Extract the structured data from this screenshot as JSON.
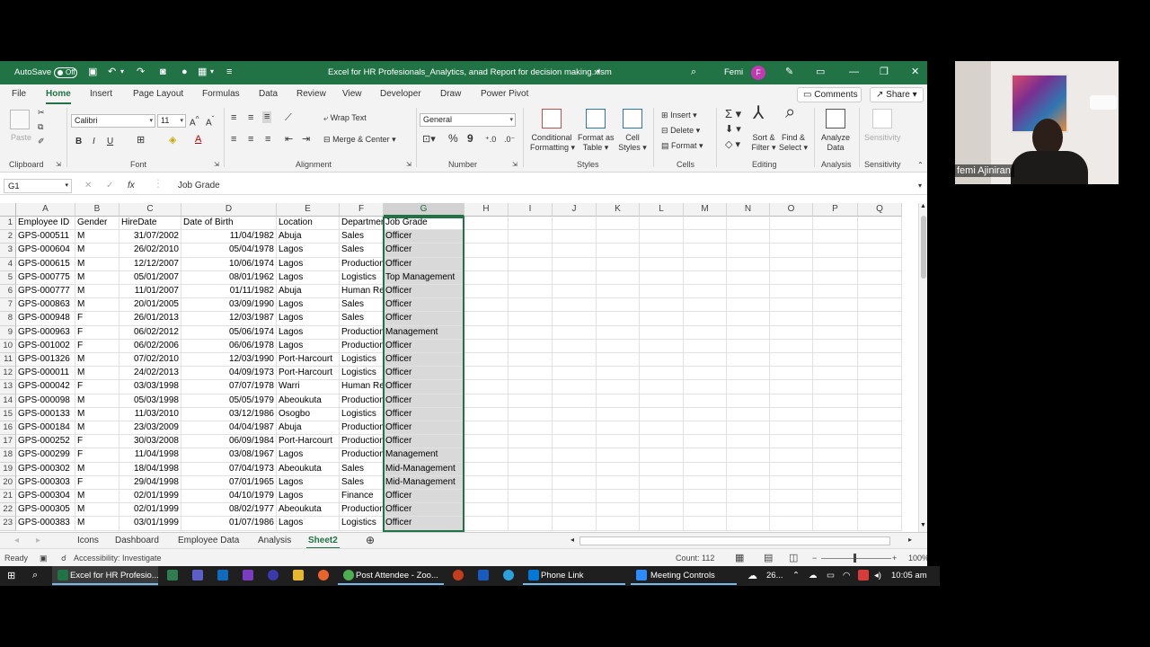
{
  "titlebar": {
    "autosave_label": "AutoSave",
    "autosave_state": "Off",
    "filename": "Excel for HR Profesionals_Analytics, anad Report for decision making.xlsm",
    "user": "Femi",
    "user_initial": "F"
  },
  "menu": {
    "tabs": [
      "File",
      "Home",
      "Insert",
      "Page Layout",
      "Formulas",
      "Data",
      "Review",
      "View",
      "Developer",
      "Draw",
      "Power Pivot"
    ],
    "active": "Home",
    "comments_label": "Comments",
    "share_label": "Share"
  },
  "ribbon": {
    "clipboard": {
      "label": "Clipboard",
      "paste": "Paste"
    },
    "font": {
      "label": "Font",
      "name": "Calibri",
      "size": "11",
      "bold": "B",
      "italic": "I",
      "underline": "U"
    },
    "alignment": {
      "label": "Alignment",
      "wrap": "Wrap Text",
      "merge": "Merge & Center"
    },
    "number": {
      "label": "Number",
      "format": "General",
      "percent": "%",
      "comma": "9"
    },
    "styles": {
      "label": "Styles",
      "conditional": [
        "Conditional",
        "Formatting"
      ],
      "format_table": [
        "Format as",
        "Table"
      ],
      "cell_styles": [
        "Cell",
        "Styles"
      ]
    },
    "cells": {
      "label": "Cells",
      "insert": "Insert",
      "delete": "Delete",
      "format": "Format"
    },
    "editing": {
      "label": "Editing",
      "sort": [
        "Sort &",
        "Filter"
      ],
      "find": [
        "Find &",
        "Select"
      ]
    },
    "analysis": {
      "label": "Analysis",
      "analyze": [
        "Analyze",
        "Data"
      ]
    },
    "sensitivity": {
      "label": "Sensitivity",
      "button": "Sensitivity"
    }
  },
  "formula_bar": {
    "name_box": "G1",
    "fx": "fx",
    "content": "Job Grade"
  },
  "grid": {
    "columns": [
      "A",
      "B",
      "C",
      "D",
      "E",
      "F",
      "G",
      "H",
      "I",
      "J",
      "K",
      "L",
      "M",
      "N",
      "O",
      "P",
      "Q"
    ],
    "selected_column": "G",
    "rows": [
      [
        "Employee ID",
        "Gender",
        "HireDate",
        "Date of Birth",
        "Location",
        "Department",
        "Job Grade"
      ],
      [
        "GPS-000511",
        "M",
        "31/07/2002",
        "11/04/1982",
        "Abuja",
        "Sales",
        "Officer"
      ],
      [
        "GPS-000604",
        "M",
        "26/02/2010",
        "05/04/1978",
        "Lagos",
        "Sales",
        "Officer"
      ],
      [
        "GPS-000615",
        "M",
        "12/12/2007",
        "10/06/1974",
        "Lagos",
        "Production",
        "Officer"
      ],
      [
        "GPS-000775",
        "M",
        "05/01/2007",
        "08/01/1962",
        "Lagos",
        "Logistics",
        "Top Management"
      ],
      [
        "GPS-000777",
        "M",
        "11/01/2007",
        "01/11/1982",
        "Abuja",
        "Human Resources",
        "Officer"
      ],
      [
        "GPS-000863",
        "M",
        "20/01/2005",
        "03/09/1990",
        "Lagos",
        "Sales",
        "Officer"
      ],
      [
        "GPS-000948",
        "F",
        "26/01/2013",
        "12/03/1987",
        "Lagos",
        "Sales",
        "Officer"
      ],
      [
        "GPS-000963",
        "F",
        "06/02/2012",
        "05/06/1974",
        "Lagos",
        "Production",
        "Management"
      ],
      [
        "GPS-001002",
        "F",
        "06/02/2006",
        "06/06/1978",
        "Lagos",
        "Production",
        "Officer"
      ],
      [
        "GPS-001326",
        "M",
        "07/02/2010",
        "12/03/1990",
        "Port-Harcourt",
        "Logistics",
        "Officer"
      ],
      [
        "GPS-000011",
        "M",
        "24/02/2013",
        "04/09/1973",
        "Port-Harcourt",
        "Logistics",
        "Officer"
      ],
      [
        "GPS-000042",
        "F",
        "03/03/1998",
        "07/07/1978",
        "Warri",
        "Human Resources",
        "Officer"
      ],
      [
        "GPS-000098",
        "M",
        "05/03/1998",
        "05/05/1979",
        "Abeoukuta",
        "Production",
        "Officer"
      ],
      [
        "GPS-000133",
        "M",
        "11/03/2010",
        "03/12/1986",
        "Osogbo",
        "Logistics",
        "Officer"
      ],
      [
        "GPS-000184",
        "M",
        "23/03/2009",
        "04/04/1987",
        "Abuja",
        "Production",
        "Officer"
      ],
      [
        "GPS-000252",
        "F",
        "30/03/2008",
        "06/09/1984",
        "Port-Harcourt",
        "Production",
        "Officer"
      ],
      [
        "GPS-000299",
        "F",
        "11/04/1998",
        "03/08/1967",
        "Lagos",
        "Production",
        "Management"
      ],
      [
        "GPS-000302",
        "M",
        "18/04/1998",
        "07/04/1973",
        "Abeoukuta",
        "Sales",
        "Mid-Management"
      ],
      [
        "GPS-000303",
        "F",
        "29/04/1998",
        "07/01/1965",
        "Lagos",
        "Sales",
        "Mid-Management"
      ],
      [
        "GPS-000304",
        "M",
        "02/01/1999",
        "04/10/1979",
        "Lagos",
        "Finance",
        "Officer"
      ],
      [
        "GPS-000305",
        "M",
        "02/01/1999",
        "08/02/1977",
        "Abeoukuta",
        "Production",
        "Officer"
      ],
      [
        "GPS-000383",
        "M",
        "03/01/1999",
        "01/07/1986",
        "Lagos",
        "Logistics",
        "Officer"
      ]
    ]
  },
  "sheets": {
    "tabs": [
      "Icons",
      "Dashboard",
      "Employee Data",
      "Analysis",
      "Sheet2"
    ],
    "active": "Sheet2"
  },
  "status": {
    "ready": "Ready",
    "accessibility": "Accessibility: Investigate",
    "count": "Count: 112",
    "zoom": "100%"
  },
  "taskbar": {
    "items": [
      "Excel for HR Profesio...",
      "Post Attendee - Zoo...",
      "Phone Link",
      "Meeting Controls"
    ],
    "weather": "26...",
    "time": "10:05 am"
  },
  "webcam": {
    "participant": "femi Ajiniran"
  }
}
